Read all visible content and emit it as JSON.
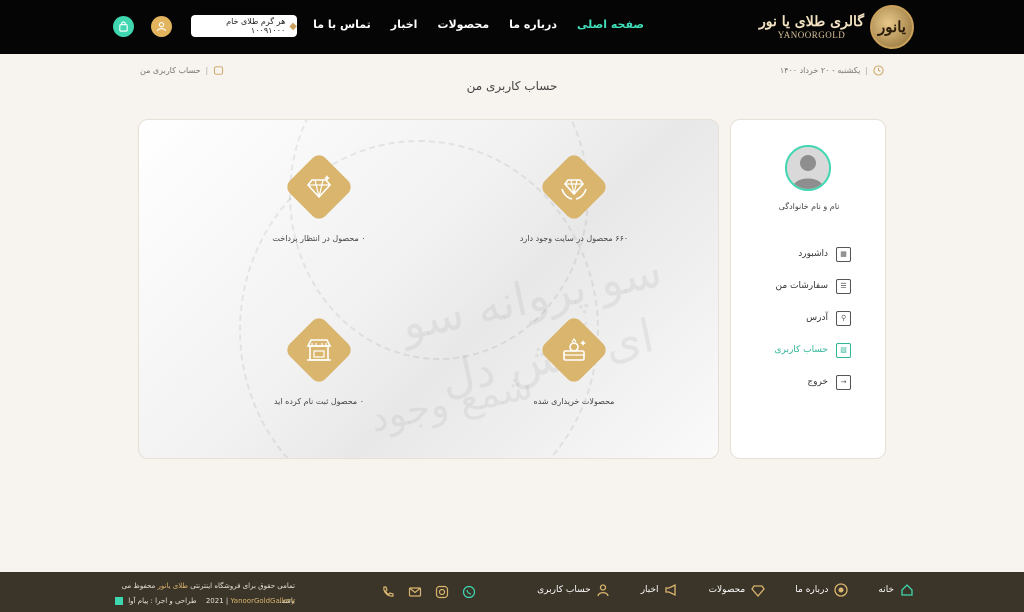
{
  "header": {
    "logo_fa": "گالری طلای یا نور",
    "logo_en": "YANOORGOLD",
    "logo_mark": "یانور",
    "nav": [
      "صفحه اصلی",
      "درباره ما",
      "محصولات",
      "اخبار",
      "تماس با ما"
    ],
    "price_text": "هر گرم طلای خام ۱۰۰۹۱۰۰۰",
    "price_icon": "diamond-icon",
    "cart_icon": "shopping-bag-icon",
    "user_icon": "user-icon",
    "accent": "#3fe0b9",
    "gold": "#d9b56e"
  },
  "date_text": "یکشنبه - ۲۰ خرداد ۱۴۰۰",
  "breadcrumb": "حساب کاربری من",
  "page_title": "حساب کاربری من",
  "stats": [
    {
      "text": "۶۶۰ محصول در سایت وجود دارد",
      "icon": "diamond-hands-icon"
    },
    {
      "text": "۰ محصول در انتظار پرداخت",
      "icon": "diamond-icon"
    },
    {
      "text": "محصولات خریداری شده",
      "icon": "ring-box-icon"
    },
    {
      "text": "۰ محصول ثبت نام کرده اید",
      "icon": "shop-icon"
    }
  ],
  "sidebar": {
    "user_name": "نام و نام خانوادگی",
    "items": [
      {
        "label": "داشبورد",
        "icon": "dashboard-icon"
      },
      {
        "label": "سفارشات من",
        "icon": "orders-icon"
      },
      {
        "label": "آدرس",
        "icon": "map-icon"
      },
      {
        "label": "حساب کاربری",
        "icon": "account-icon"
      },
      {
        "label": "خروج",
        "icon": "logout-icon"
      }
    ]
  },
  "footer": {
    "nav": [
      "خانه",
      "درباره ما",
      "محصولات",
      "اخبار",
      "حساب کاربری"
    ],
    "copyright_pre": "تمامی حقوق برای فروشگاه اینترنتی",
    "copyright_brand": "طلای یانور",
    "copyright_post": "محفوظ می باشد.",
    "design": "طراحی و اجرا : پیام آوا",
    "gallery_year": "2021",
    "gallery_name": "YanoorGoldGallery"
  }
}
